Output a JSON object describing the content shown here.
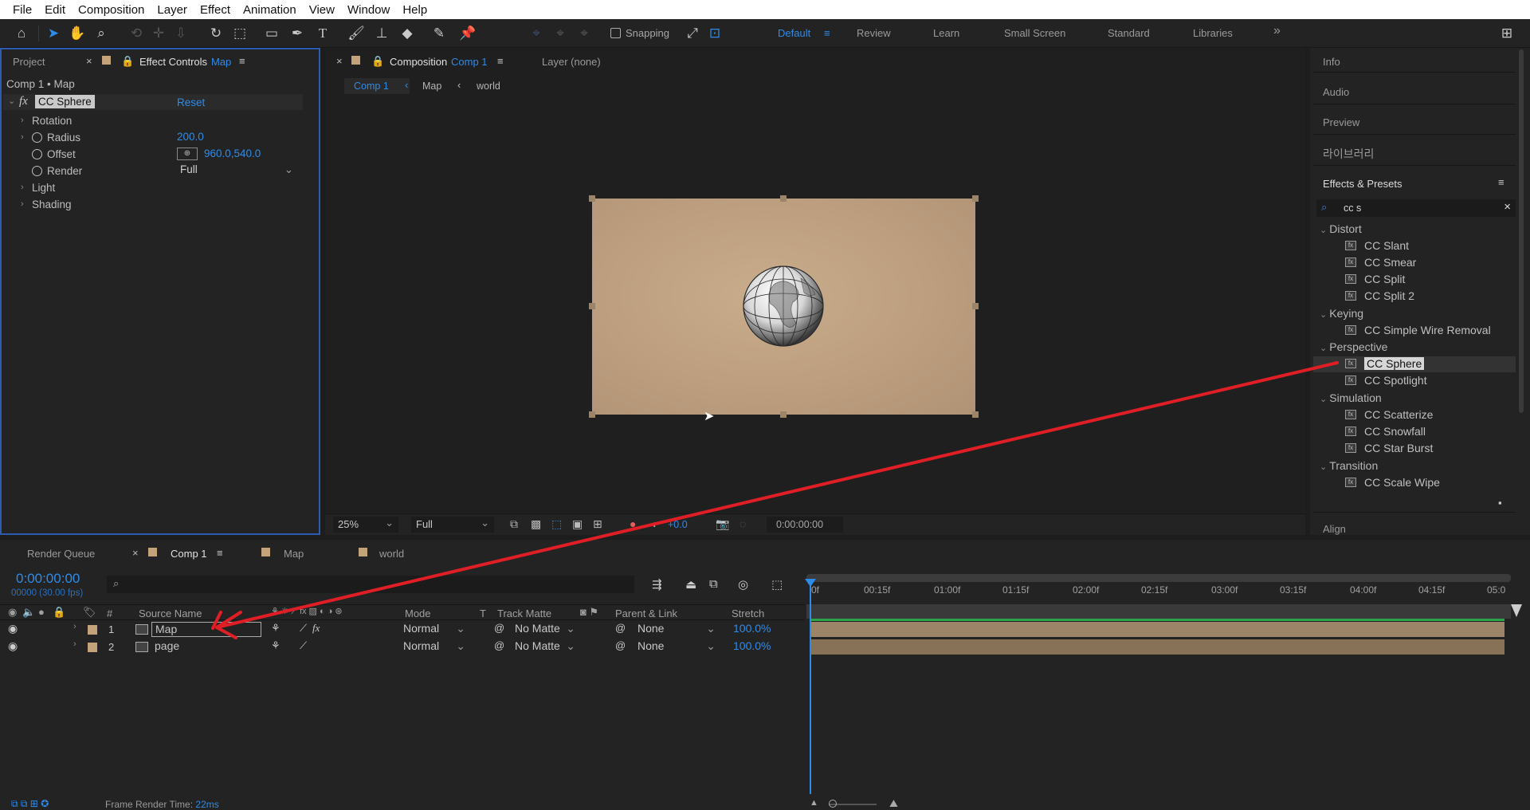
{
  "menu": [
    "File",
    "Edit",
    "Composition",
    "Layer",
    "Effect",
    "Animation",
    "View",
    "Window",
    "Help"
  ],
  "toolbar": {
    "snapping_label": "Snapping",
    "workspaces": [
      "Default",
      "Review",
      "Learn",
      "Small Screen",
      "Standard",
      "Libraries"
    ],
    "active_workspace": "Default"
  },
  "left_panel": {
    "tab_project": "Project",
    "tab_effect_controls": "Effect Controls",
    "tab_effect_controls_layer": "Map",
    "breadcrumb": "Comp 1 • Map",
    "effect_name": "CC Sphere",
    "reset_label": "Reset",
    "properties": {
      "rotation": "Rotation",
      "radius_label": "Radius",
      "radius_value": "200.0",
      "offset_label": "Offset",
      "offset_value": "960.0,540.0",
      "render_label": "Render",
      "render_value": "Full",
      "light": "Light",
      "shading": "Shading"
    }
  },
  "viewer": {
    "tab_label": "Composition",
    "tab_comp": "Comp 1",
    "layer_tab": "Layer (none)",
    "crumbs": [
      "Comp 1",
      "Map",
      "world"
    ],
    "zoom": "25%",
    "resolution": "Full",
    "exposure": "+0.0",
    "timecode": "0:00:00:00"
  },
  "right_panel": {
    "info": "Info",
    "audio": "Audio",
    "preview": "Preview",
    "library": "라이브러리",
    "effects_title": "Effects & Presets",
    "search_value": "cc s",
    "align": "Align",
    "categories": [
      {
        "name": "Distort",
        "items": [
          "CC Slant",
          "CC Smear",
          "CC Split",
          "CC Split 2"
        ]
      },
      {
        "name": "Keying",
        "items": [
          "CC Simple Wire Removal"
        ]
      },
      {
        "name": "Perspective",
        "items": [
          "CC Sphere",
          "CC Spotlight"
        ]
      },
      {
        "name": "Simulation",
        "items": [
          "CC Scatterize",
          "CC Snowfall",
          "CC Star Burst"
        ]
      },
      {
        "name": "Transition",
        "items": [
          "CC Scale Wipe"
        ]
      }
    ],
    "selected_effect": "CC Sphere"
  },
  "timeline": {
    "tab_render_queue": "Render Queue",
    "tab_comp1": "Comp 1",
    "tab_map": "Map",
    "tab_world": "world",
    "timecode": "0:00:00:00",
    "fps": "00000 (30.00 fps)",
    "col_hash": "#",
    "col_source": "Source Name",
    "col_mode": "Mode",
    "col_t": "T",
    "col_track": "Track Matte",
    "col_parent": "Parent & Link",
    "col_stretch": "Stretch",
    "ruler": [
      "00:15f",
      "01:00f",
      "01:15f",
      "02:00f",
      "02:15f",
      "03:00f",
      "03:15f",
      "04:00f",
      "04:15f",
      "05:0"
    ],
    "ruler_start": "0f",
    "layers": [
      {
        "num": "1",
        "name": "Map",
        "mode": "Normal",
        "track": "No Matte",
        "parent": "None",
        "stretch": "100.0%"
      },
      {
        "num": "2",
        "name": "page",
        "mode": "Normal",
        "track": "No Matte",
        "parent": "None",
        "stretch": "100.0%"
      }
    ],
    "render_time_label": "Frame Render Time:",
    "render_time_value": "22ms"
  }
}
